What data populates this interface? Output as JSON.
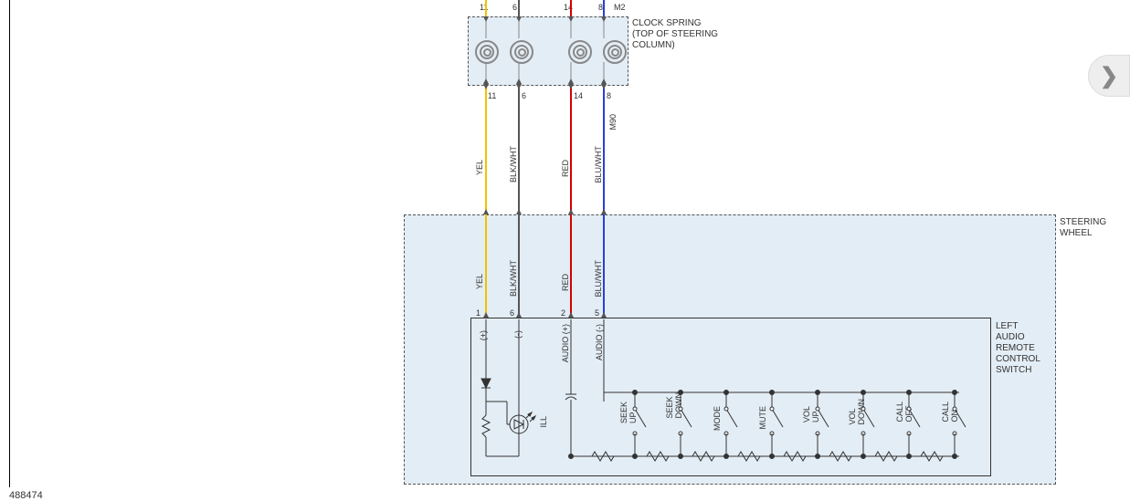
{
  "ref_number": "488474",
  "blocks": {
    "clock_spring": {
      "title_line1": "CLOCK SPRING",
      "title_line2": "(TOP OF STEERING",
      "title_line3": "COLUMN)"
    },
    "steering_wheel": {
      "title": "STEERING",
      "title2": "WHEEL"
    },
    "switch_box": {
      "title_line1": "LEFT",
      "title_line2": "AUDIO",
      "title_line3": "REMOTE",
      "title_line4": "CONTROL",
      "title_line5": "SWITCH"
    }
  },
  "wires": [
    {
      "pin_top": "11",
      "pin_mid": "11",
      "pin_bot": "1",
      "color_code": "YEL",
      "stroke": "#f2c200",
      "signal": "(+)"
    },
    {
      "pin_top": "6",
      "pin_mid": "6",
      "pin_bot": "6",
      "color_code": "BLK/WHT",
      "stroke": "#555555",
      "signal": "(-)"
    },
    {
      "pin_top": "14",
      "pin_mid": "14",
      "pin_bot": "2",
      "color_code": "RED",
      "stroke": "#d40000",
      "signal": "AUDIO (+)"
    },
    {
      "pin_top": "8",
      "pin_mid": "8",
      "pin_bot": "5",
      "color_code": "BLU/WHT",
      "stroke": "#2a3fd6",
      "signal": "AUDIO (-)"
    }
  ],
  "connector_mid": "M2",
  "connector_bot": "M90",
  "switches": [
    {
      "name": "ILL"
    },
    {
      "name": "SEEK UP"
    },
    {
      "name": "SEEK DOWN"
    },
    {
      "name": "MODE"
    },
    {
      "name": "MUTE"
    },
    {
      "name": "VOL UP"
    },
    {
      "name": "VOL DOWN"
    },
    {
      "name": "CALL OFF"
    },
    {
      "name": "CALL ON"
    }
  ],
  "nav": {
    "next": "❯"
  }
}
